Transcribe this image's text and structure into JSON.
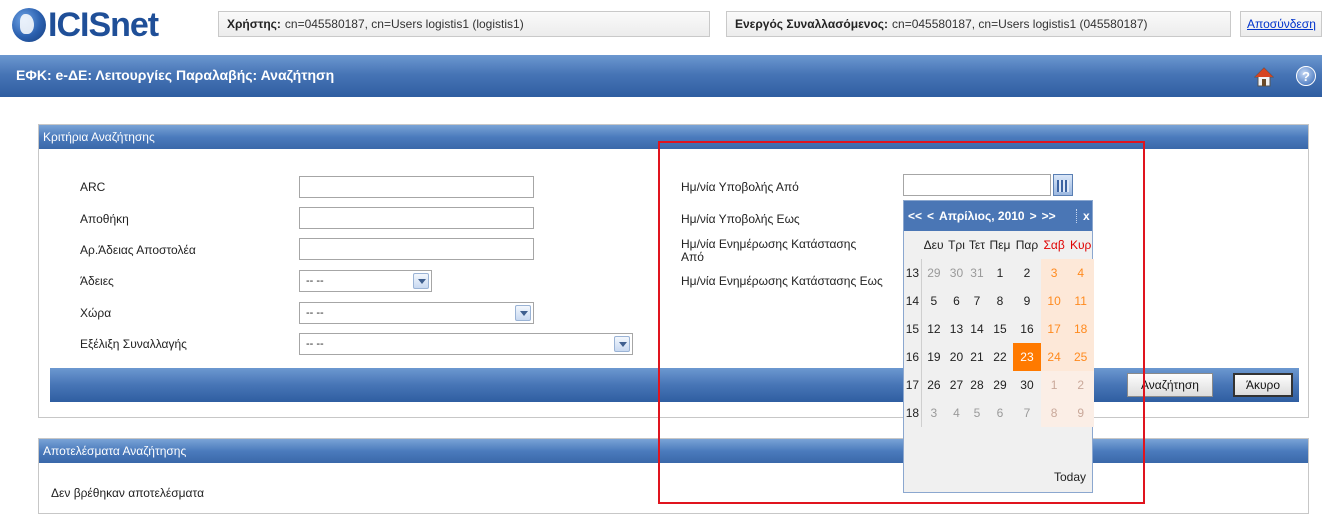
{
  "header": {
    "logo_text": "ICISnet",
    "user_label": "Χρήστης:",
    "user_value": "cn=045580187, cn=Users logistis1 (logistis1)",
    "trader_label": "Ενεργός Συναλλασόμενος:",
    "trader_value": "cn=045580187, cn=Users logistis1 (045580187)",
    "logout": "Αποσύνδεση"
  },
  "titlebar": {
    "title": "ΕΦΚ: e-ΔΕ: Λειτουργίες Παραλαβής: Αναζήτηση",
    "help_glyph": "?"
  },
  "criteria": {
    "title": "Κριτήρια Αναζήτησης",
    "left_fields": [
      {
        "label": "ARC",
        "value": ""
      },
      {
        "label": "Αποθήκη",
        "value": ""
      },
      {
        "label": "Αρ.Άδειας Αποστολέα",
        "value": ""
      },
      {
        "label": "Άδειες",
        "value": "-- --"
      },
      {
        "label": "Χώρα",
        "value": "-- --"
      },
      {
        "label": "Εξέλιξη Συναλλαγής",
        "value": "-- --"
      }
    ],
    "right_fields": [
      {
        "label": "Ημ/νία Υποβολής Από"
      },
      {
        "label": "Ημ/νία Υποβολής Εως"
      },
      {
        "label": "Ημ/νία Ενημέρωσης Κατάστασης Από"
      },
      {
        "label": "Ημ/νία Ενημέρωσης Κατάστασης Εως"
      }
    ],
    "search_button": "Αναζήτηση",
    "cancel_button": "Άκυρο"
  },
  "calendar": {
    "nav_prev_year": "<<",
    "nav_prev_month": "<",
    "month_label": "Απρίλιος, 2010",
    "nav_next_month": ">",
    "nav_next_year": ">>",
    "close": "x",
    "weekday_labels": [
      "Δευ",
      "Τρι",
      "Τετ",
      "Πεμ",
      "Παρ",
      "Σαβ",
      "Κυρ"
    ],
    "weeks": [
      {
        "week": "13",
        "days": [
          "29",
          "30",
          "31",
          "1",
          "2",
          "3",
          "4"
        ]
      },
      {
        "week": "14",
        "days": [
          "5",
          "6",
          "7",
          "8",
          "9",
          "10",
          "11"
        ]
      },
      {
        "week": "15",
        "days": [
          "12",
          "13",
          "14",
          "15",
          "16",
          "17",
          "18"
        ]
      },
      {
        "week": "16",
        "days": [
          "19",
          "20",
          "21",
          "22",
          "23",
          "24",
          "25"
        ]
      },
      {
        "week": "17",
        "days": [
          "26",
          "27",
          "28",
          "29",
          "30",
          "1",
          "2"
        ]
      },
      {
        "week": "18",
        "days": [
          "3",
          "4",
          "5",
          "6",
          "7",
          "8",
          "9"
        ]
      }
    ],
    "selected_day": "23",
    "today_label": "Today"
  },
  "results": {
    "title": "Αποτελέσματα Αναζήτησης",
    "message": "Δεν βρέθηκαν αποτελέσματα"
  },
  "colors": {
    "accent": "#4775b6",
    "highlight": "#ff7a00",
    "annotation": "#e0141e"
  }
}
